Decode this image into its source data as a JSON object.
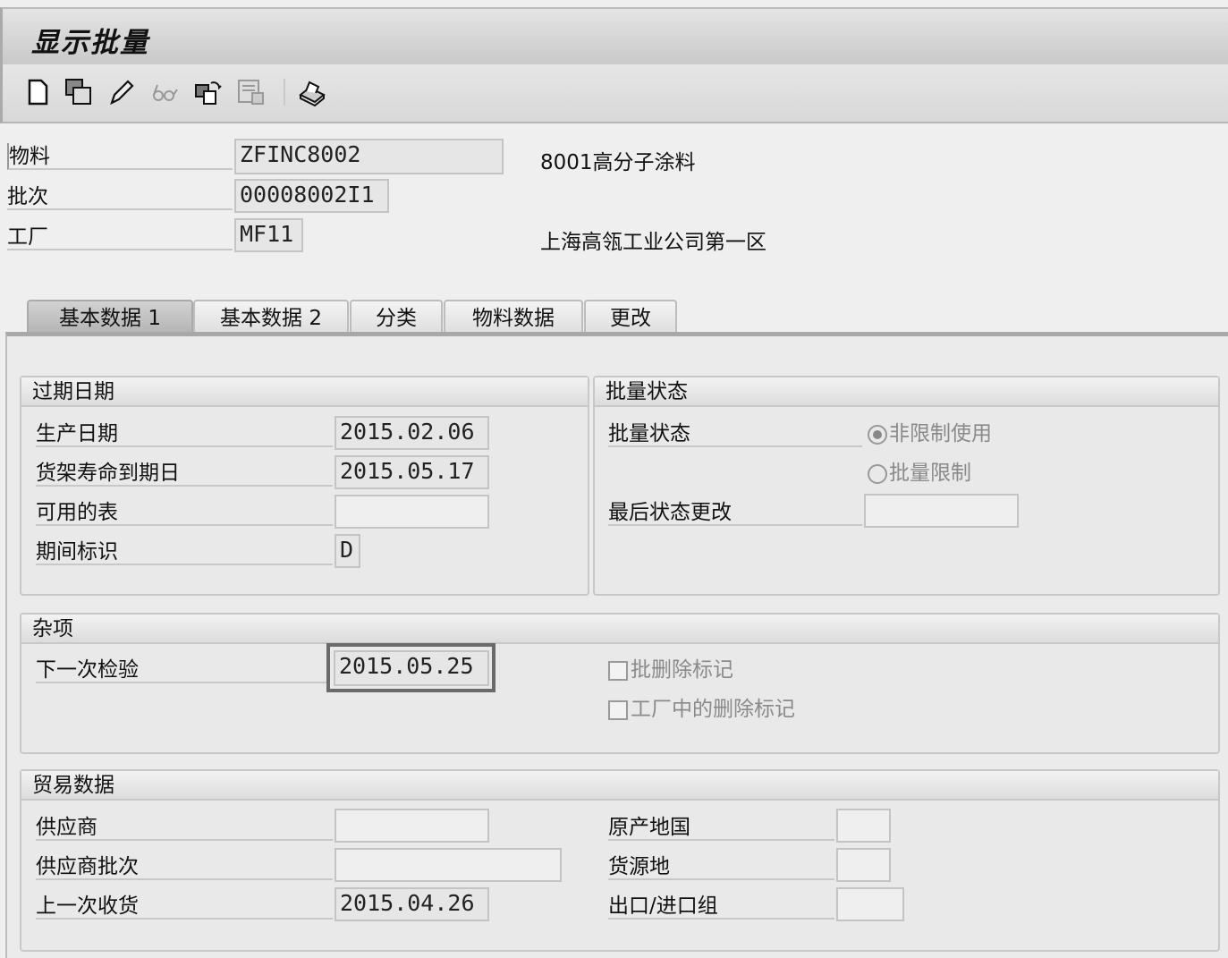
{
  "window": {
    "title": "显示批量"
  },
  "toolbar": {
    "icons": [
      "new-document-icon",
      "copy-icon",
      "edit-pencil-icon",
      "display-glasses-icon",
      "change-icon",
      "delete-icon",
      "print-icon"
    ]
  },
  "header": {
    "material_label": "物料",
    "material_value": "ZFINC8002",
    "material_desc": "8001高分子涂料",
    "batch_label": "批次",
    "batch_value": "00008002I1",
    "plant_label": "工厂",
    "plant_value": "MF11",
    "plant_desc": "上海高瓴工业公司第一区"
  },
  "tabs": [
    {
      "label": "基本数据 1",
      "active": true
    },
    {
      "label": "基本数据 2"
    },
    {
      "label": "分类"
    },
    {
      "label": "物料数据"
    },
    {
      "label": "更改"
    }
  ],
  "expiry": {
    "title": "过期日期",
    "prod_date_label": "生产日期",
    "prod_date": "2015.02.06",
    "shelf_label": "货架寿命到期日",
    "shelf_date": "2015.05.17",
    "avail_label": "可用的表",
    "avail_value": "",
    "period_label": "期间标识",
    "period_value": "D"
  },
  "status": {
    "title": "批量状态",
    "label": "批量状态",
    "opt_unrestricted": "非限制使用",
    "opt_restricted": "批量限制",
    "selected": "非限制使用",
    "last_change_label": "最后状态更改",
    "last_change_value": ""
  },
  "misc": {
    "title": "杂项",
    "next_insp_label": "下一次检验",
    "next_insp_value": "2015.05.25",
    "del_flag_label": "批删除标记",
    "plant_del_label": "工厂中的删除标记"
  },
  "trade": {
    "title": "贸易数据",
    "vendor_label": "供应商",
    "vendor_value": "",
    "vendor_batch_label": "供应商批次",
    "vendor_batch_value": "",
    "last_gr_label": "上一次收货",
    "last_gr_value": "2015.04.26",
    "origin_country_label": "原产地国",
    "origin_country_value": "",
    "origin_region_label": "货源地",
    "origin_region_value": "",
    "ex_im_label": "出口/进口组",
    "ex_im_value": ""
  }
}
